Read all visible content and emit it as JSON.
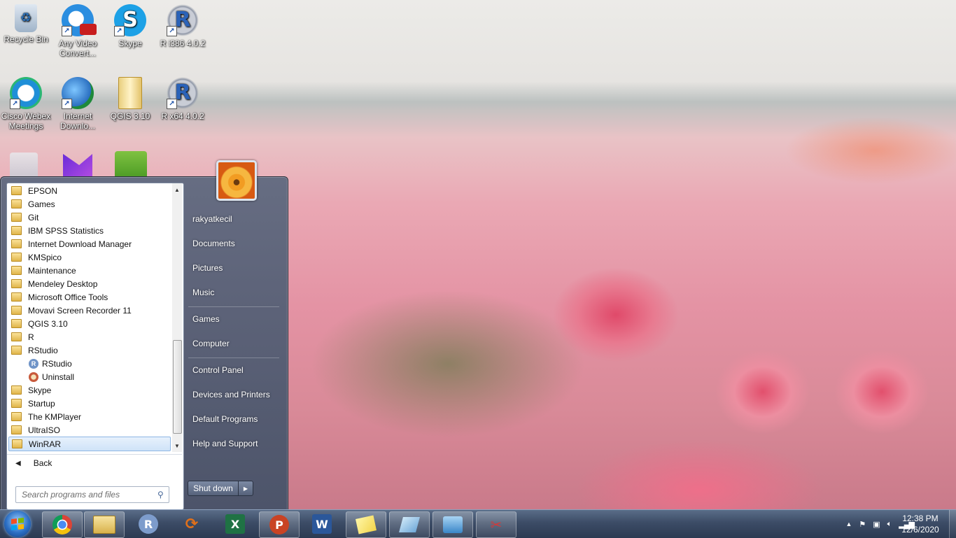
{
  "desktop": {
    "icons": [
      {
        "label": "Recycle Bin",
        "icon": "recycle-bin-icon"
      },
      {
        "label": "Any Video Convert...",
        "icon": "video-converter-icon"
      },
      {
        "label": "Skype",
        "icon": "skype-icon"
      },
      {
        "label": "R i386 4.0.2",
        "icon": "r-icon"
      },
      {
        "label": "Cisco Webex Meetings",
        "icon": "webex-icon"
      },
      {
        "label": "Internet Downlo...",
        "icon": "idm-icon"
      },
      {
        "label": "QGIS 3.10",
        "icon": "folder-icon"
      },
      {
        "label": "R x64 4.0.2",
        "icon": "r-icon"
      }
    ]
  },
  "start_menu": {
    "programs": [
      {
        "label": "EPSON",
        "type": "folder"
      },
      {
        "label": "Games",
        "type": "folder"
      },
      {
        "label": "Git",
        "type": "folder"
      },
      {
        "label": "IBM SPSS Statistics",
        "type": "folder"
      },
      {
        "label": "Internet Download Manager",
        "type": "folder"
      },
      {
        "label": "KMSpico",
        "type": "folder"
      },
      {
        "label": "Maintenance",
        "type": "folder"
      },
      {
        "label": "Mendeley Desktop",
        "type": "folder"
      },
      {
        "label": "Microsoft Office Tools",
        "type": "folder"
      },
      {
        "label": "Movavi Screen Recorder 11",
        "type": "folder"
      },
      {
        "label": "QGIS 3.10",
        "type": "folder"
      },
      {
        "label": "R",
        "type": "folder"
      },
      {
        "label": "RStudio",
        "type": "folder"
      },
      {
        "label": "RStudio",
        "type": "app"
      },
      {
        "label": "Uninstall",
        "type": "app"
      },
      {
        "label": "Skype",
        "type": "folder"
      },
      {
        "label": "Startup",
        "type": "folder"
      },
      {
        "label": "The KMPlayer",
        "type": "folder"
      },
      {
        "label": "UltraISO",
        "type": "folder"
      },
      {
        "label": "WinRAR",
        "type": "folder"
      }
    ],
    "back_label": "Back",
    "search_placeholder": "Search programs and files",
    "right_items": {
      "user": "rakyatkecil",
      "documents": "Documents",
      "pictures": "Pictures",
      "music": "Music",
      "games": "Games",
      "computer": "Computer",
      "control_panel": "Control Panel",
      "devices": "Devices and Printers",
      "default_programs": "Default Programs",
      "help": "Help and Support"
    },
    "shutdown_label": "Shut down"
  },
  "taskbar": {
    "apps": [
      "chrome",
      "file-explorer",
      "r",
      "rstudio-tool",
      "excel",
      "powerpoint",
      "word",
      "sticky-notes",
      "snipping-eraser",
      "control-panel",
      "paint"
    ],
    "time": "12:38 PM",
    "date": "12/6/2020"
  }
}
